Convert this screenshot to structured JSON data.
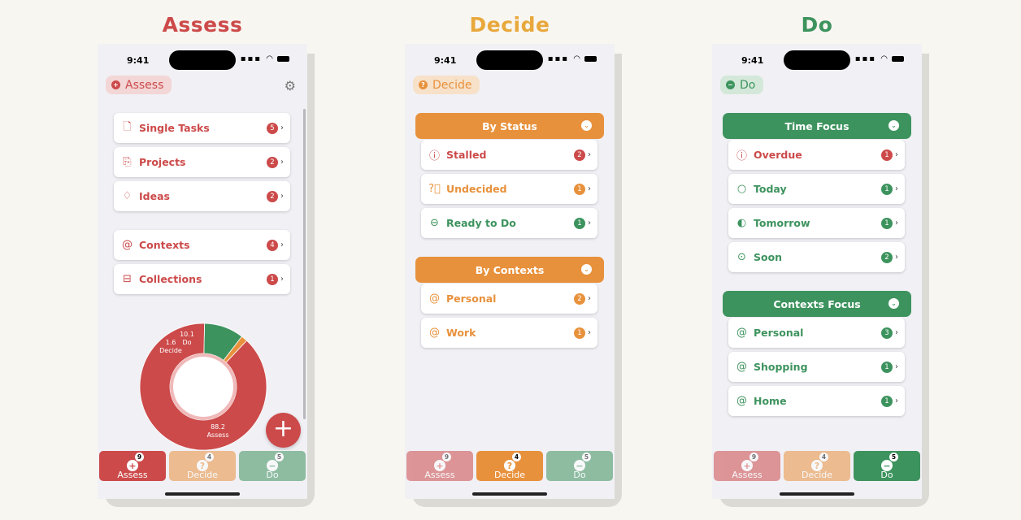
{
  "colors": {
    "assess": "#cc4a4a",
    "decide": "#e8913c",
    "do": "#3d935e",
    "background": "#f8f6f1",
    "phone_bg": "#f1f0f5"
  },
  "columns": [
    {
      "heading": "Assess",
      "status": {
        "time": "9:41"
      },
      "pill": {
        "label": "Assess",
        "icon": "plus-circle-icon"
      },
      "rows": [
        {
          "label": "Single Tasks",
          "icon": "document-icon",
          "count": "5"
        },
        {
          "label": "Projects",
          "icon": "documents-icon",
          "count": "2"
        },
        {
          "label": "Ideas",
          "icon": "lightbulb-icon",
          "count": "2"
        },
        {
          "label": "Contexts",
          "icon": "at-icon",
          "count": "4"
        },
        {
          "label": "Collections",
          "icon": "tray-icon",
          "count": "1"
        }
      ],
      "chart_data": {
        "type": "pie",
        "labels": [
          "Assess",
          "Decide",
          "Do"
        ],
        "values": [
          88.2,
          1.6,
          10.1
        ],
        "colors": [
          "#cc4a4a",
          "#e8913c",
          "#3d935e"
        ],
        "slice_labels": [
          {
            "value": "88.2",
            "name": "Assess"
          },
          {
            "value": "1.6",
            "name": "Decide"
          },
          {
            "value": "10.1",
            "name": "Do"
          }
        ]
      },
      "fab": "+",
      "tabs": [
        {
          "label": "Assess",
          "count": "9",
          "glyph": "+"
        },
        {
          "label": "Decide",
          "count": "4",
          "glyph": "?"
        },
        {
          "label": "Do",
          "count": "5",
          "glyph": "−"
        }
      ]
    },
    {
      "heading": "Decide",
      "status": {
        "time": "9:41"
      },
      "pill": {
        "label": "Decide",
        "icon": "question-circle-icon"
      },
      "sections": [
        {
          "title": "By Status",
          "rows": [
            {
              "label": "Stalled",
              "icon": "exclamation-circle-icon",
              "count": "2",
              "color": "#cc4a4a"
            },
            {
              "label": "Undecided",
              "icon": "question-circle-icon",
              "count": "1",
              "color": "#e8913c"
            },
            {
              "label": "Ready to Do",
              "icon": "minus-circle-icon",
              "count": "1",
              "color": "#3d935e"
            }
          ]
        },
        {
          "title": "By Contexts",
          "rows": [
            {
              "label": "Personal",
              "icon": "at-icon",
              "count": "2",
              "color": "#e8913c"
            },
            {
              "label": "Work",
              "icon": "at-icon",
              "count": "1",
              "color": "#e8913c"
            }
          ]
        }
      ],
      "tabs": [
        {
          "label": "Assess",
          "count": "9",
          "glyph": "+"
        },
        {
          "label": "Decide",
          "count": "4",
          "glyph": "?"
        },
        {
          "label": "Do",
          "count": "5",
          "glyph": "−"
        }
      ]
    },
    {
      "heading": "Do",
      "status": {
        "time": "9:41"
      },
      "pill": {
        "label": "Do",
        "icon": "minus-circle-icon"
      },
      "sections": [
        {
          "title": "Time Focus",
          "rows": [
            {
              "label": "Overdue",
              "icon": "exclamation-circle-icon",
              "count": "1",
              "color": "#cc4a4a"
            },
            {
              "label": "Today",
              "icon": "circle-icon",
              "count": "1",
              "color": "#3d935e"
            },
            {
              "label": "Tomorrow",
              "icon": "half-circle-icon",
              "count": "1",
              "color": "#3d935e"
            },
            {
              "label": "Soon",
              "icon": "dot-circle-icon",
              "count": "2",
              "color": "#3d935e"
            }
          ]
        },
        {
          "title": "Contexts Focus",
          "rows": [
            {
              "label": "Personal",
              "icon": "at-icon",
              "count": "3",
              "color": "#3d935e"
            },
            {
              "label": "Shopping",
              "icon": "at-icon",
              "count": "1",
              "color": "#3d935e"
            },
            {
              "label": "Home",
              "icon": "at-icon",
              "count": "1",
              "color": "#3d935e"
            }
          ]
        }
      ],
      "tabs": [
        {
          "label": "Assess",
          "count": "9",
          "glyph": "+"
        },
        {
          "label": "Decide",
          "count": "4",
          "glyph": "?"
        },
        {
          "label": "Do",
          "count": "5",
          "glyph": "−"
        }
      ]
    }
  ]
}
